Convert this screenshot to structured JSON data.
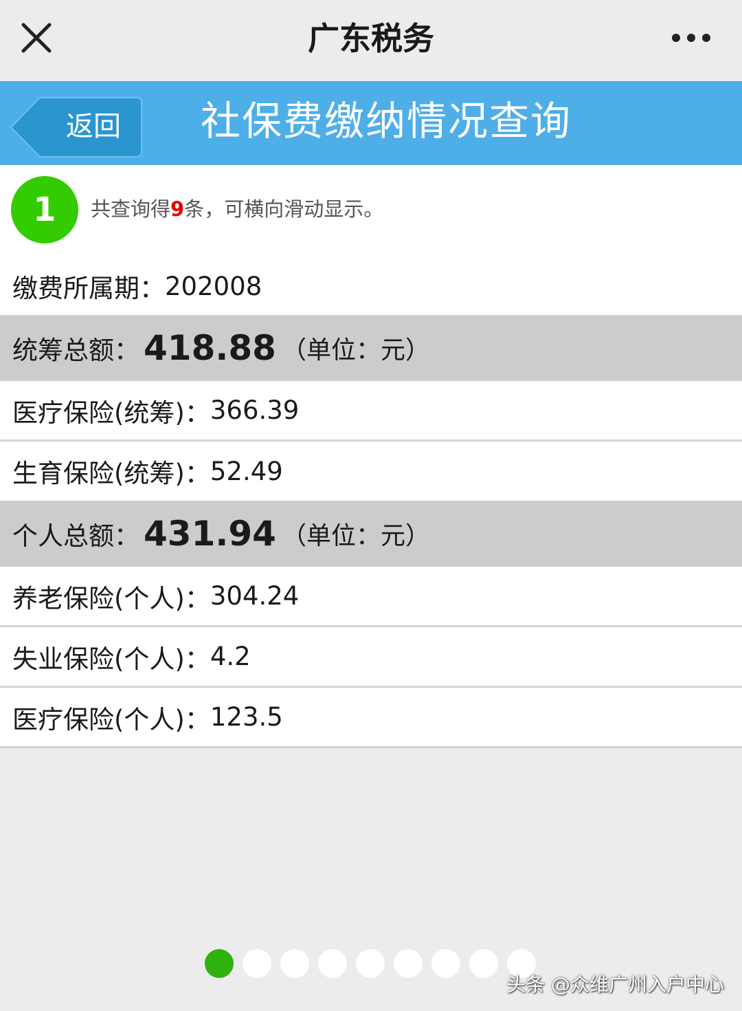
{
  "appbar": {
    "title": "广东税务",
    "close_icon": "close-icon",
    "more_icon": "more-icon"
  },
  "header": {
    "back_label": "返回",
    "title": "社保费缴纳情况查询",
    "color": "#4eaee8"
  },
  "result": {
    "index": "1",
    "msg_prefix": "共查询得",
    "count": "9",
    "msg_suffix": "条，可横向滑动显示。"
  },
  "period": {
    "label": "缴费所属期：",
    "value": "202008"
  },
  "pooled_total": {
    "label": "统筹总额：",
    "value": "418.88",
    "unit": "（单位：元）"
  },
  "pooled_items": [
    {
      "label": "医疗保险(统筹)：",
      "value": "366.39"
    },
    {
      "label": "生育保险(统筹)：",
      "value": "52.49"
    }
  ],
  "personal_total": {
    "label": "个人总额：",
    "value": "431.94",
    "unit": "（单位：元）"
  },
  "personal_items": [
    {
      "label": "养老保险(个人)：",
      "value": "304.24"
    },
    {
      "label": "失业保险(个人)：",
      "value": "4.2"
    },
    {
      "label": "医疗保险(个人)：",
      "value": "123.5"
    }
  ],
  "pager": {
    "total": 9,
    "active": 1,
    "active_color": "#2fb10f"
  },
  "watermark": "头条 @众维广州入户中心"
}
